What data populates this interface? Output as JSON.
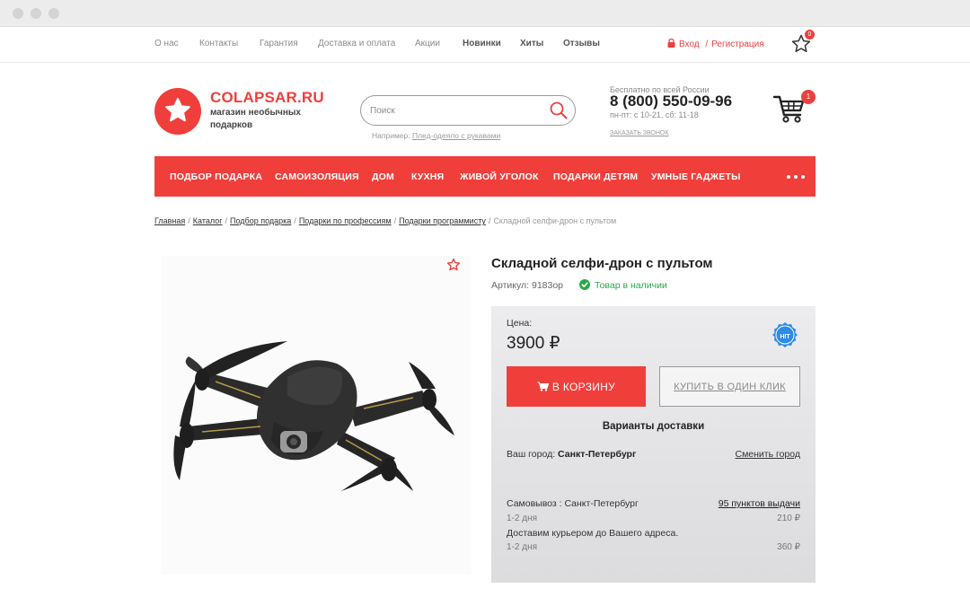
{
  "top_nav": {
    "links": [
      "О нас",
      "Контакты",
      "Гарантия",
      "Доставка и оплата",
      "Акции",
      "Новинки",
      "Хиты",
      "Отзывы"
    ],
    "login": "Вход",
    "separator": "/",
    "register": "Регистрация",
    "favorites_count": "0"
  },
  "header": {
    "logo_name": "COLAPSAR.RU",
    "logo_tagline": "магазин необычных подарков",
    "search_placeholder": "Поиск",
    "search_hint_prefix": "Например:",
    "search_hint_link": "Плед-одеяло с рукавами",
    "phone_note": "Бесплатно по всей России",
    "phone": "8 (800) 550-09-96",
    "hours": "пн-пт: с 10-21, сб: 11-18",
    "callback": "ЗАКАЗАТЬ ЗВОНОК",
    "cart_count": "1"
  },
  "category_nav": [
    "ПОДБОР ПОДАРКА",
    "САМОИЗОЛЯЦИЯ",
    "ДОМ",
    "КУХНЯ",
    "ЖИВОЙ УГОЛОК",
    "ПОДАРКИ ДЕТЯМ",
    "УМНЫЕ ГАДЖЕТЫ"
  ],
  "breadcrumb": {
    "items": [
      "Главная",
      "Каталог",
      "Подбор подарка",
      "Подарки по профессиям",
      "Подарки программисту"
    ],
    "current": "Складной селфи-дрон с пультом"
  },
  "product": {
    "title": "Складной селфи-дрон с пультом",
    "article": "Артикул: 9183ор",
    "stock": "Товар в наличии",
    "price_label": "Цена:",
    "price": "3900 ₽",
    "hit_label": "HIT",
    "add_to_cart": "В КОРЗИНУ",
    "one_click": "КУПИТЬ В ОДИН КЛИК"
  },
  "delivery": {
    "title": "Варианты доставки",
    "city_label": "Ваш город:",
    "city": "Санкт-Петербург",
    "change_city": "Сменить город",
    "pickup": "Самовывоз : Санкт-Петербург",
    "pickup_points": "95 пунктов выдачи",
    "pickup_days": "1-2 дня",
    "pickup_price": "210 ₽",
    "courier": "Доставим курьером до Вашего адреса.",
    "courier_days": "1-2 дня",
    "courier_price": "360 ₽"
  },
  "colors": {
    "accent": "#f03f3b",
    "stock_green": "#2ba84a",
    "hit_blue": "#2e8be8"
  }
}
